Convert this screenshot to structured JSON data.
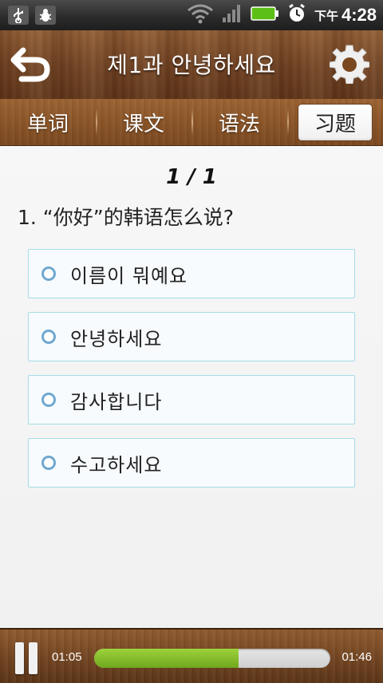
{
  "status_bar": {
    "icons": [
      "usb-icon",
      "bug-icon",
      "wifi-icon",
      "signal-icon",
      "battery-icon",
      "alarm-icon"
    ],
    "time_prefix": "下午",
    "time": "4:28"
  },
  "header": {
    "title": "제1과 안녕하세요",
    "back_icon": "back-arrow-icon",
    "settings_icon": "gear-icon"
  },
  "tabs": [
    {
      "label": "单词",
      "active": false
    },
    {
      "label": "课文",
      "active": false
    },
    {
      "label": "语法",
      "active": false
    },
    {
      "label": "习题",
      "active": true
    }
  ],
  "quiz": {
    "counter": "1 / 1",
    "question": "1. “你好”的韩语怎么说?",
    "options": [
      "이름이 뭐예요",
      "안녕하세요",
      "감사합니다",
      "수고하세요"
    ]
  },
  "player": {
    "current_time": "01:05",
    "duration": "01:46",
    "progress_percent": 61.3,
    "pause_icon": "pause-icon"
  },
  "colors": {
    "wood": "#7a4820",
    "option_border": "#a6dce6",
    "radio": "#6fa8d0",
    "progress_fill": "#8cc432"
  }
}
